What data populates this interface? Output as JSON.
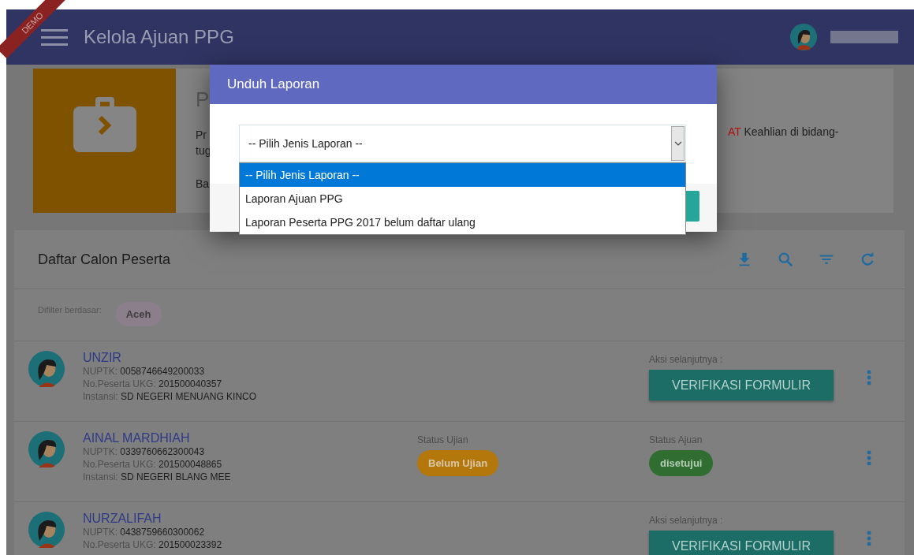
{
  "ribbon": "DEMO",
  "header": {
    "title": "Kelola Ajuan PPG"
  },
  "info_card": {
    "heading": "P",
    "lines": [
      "Pr",
      "tug",
      "Ba"
    ],
    "highlight": "AT",
    "right_text": "Keahlian di bidang-"
  },
  "modal": {
    "title": "Unduh Laporan",
    "select": {
      "value": "-- Pilih Jenis Laporan --",
      "expanded": true
    },
    "options": [
      {
        "label": "-- Pilih Jenis Laporan --",
        "selected": true
      },
      {
        "label": "Laporan Ajuan PPG",
        "selected": false
      },
      {
        "label": "Laporan Peserta PPG 2017 belum daftar ulang",
        "selected": false
      }
    ]
  },
  "list": {
    "title": "Daftar Calon Peserta",
    "filter_label": "Difilter berdasar:",
    "filter_chips": [
      "Aceh"
    ],
    "rows": [
      {
        "name": "UNZIR",
        "fields": [
          {
            "label": "NUPTK:",
            "value": "0058746649200033"
          },
          {
            "label": "No.Peserta UKG:",
            "value": "201500040357"
          },
          {
            "label": "Instansi:",
            "value": "SD NEGERI MENUANG KINCO"
          }
        ],
        "kind": "action",
        "action_label": "Aksi selanjutnya :",
        "action": "VERIFIKASI FORMULIR"
      },
      {
        "name": "AINAL MARDHIAH",
        "fields": [
          {
            "label": "NUPTK:",
            "value": "0339760662300043"
          },
          {
            "label": "No.Peserta UKG:",
            "value": "201500048865"
          },
          {
            "label": "Instansi:",
            "value": "SD NEGERI BLANG MEE"
          }
        ],
        "kind": "status",
        "statuses": [
          {
            "label": "Status Ujian",
            "value": "Belum Ujian",
            "color": "#b3770b"
          },
          {
            "label": "Status Ajuan",
            "value": "disetujui",
            "color": "#2f6d31"
          }
        ]
      },
      {
        "name": "NURZALIFAH",
        "fields": [
          {
            "label": "NUPTK:",
            "value": "0438759660300062"
          },
          {
            "label": "No.Peserta UKG:",
            "value": "201500023392"
          }
        ],
        "kind": "action",
        "action_label": "Aksi selanjutnya :",
        "action": "VERIFIKASI FORMULIR"
      }
    ]
  }
}
